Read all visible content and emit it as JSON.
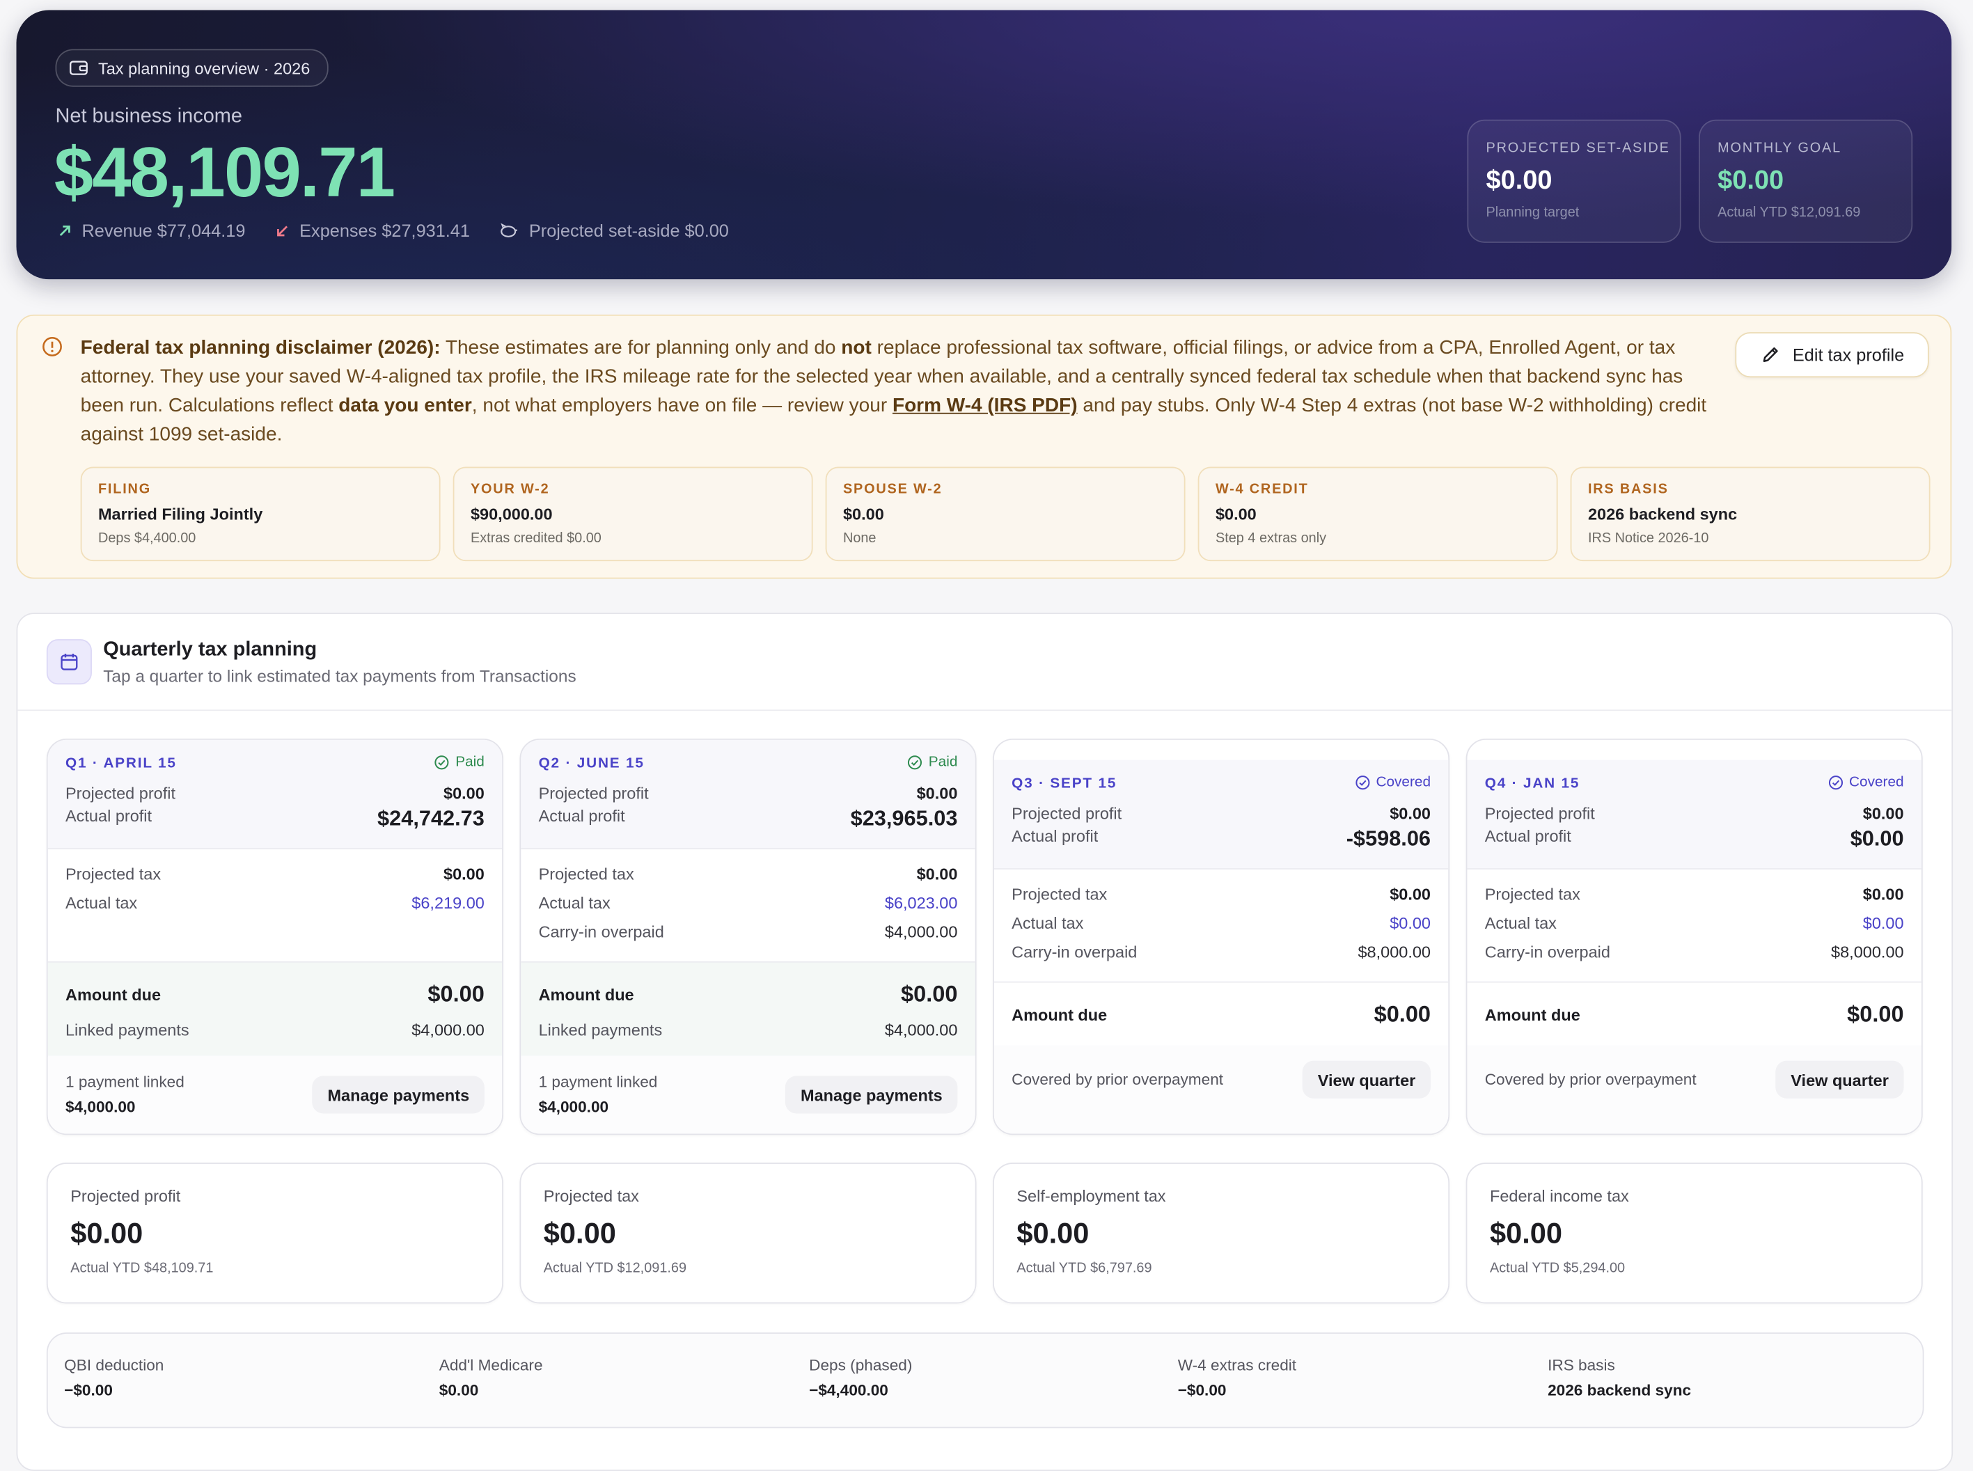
{
  "hero": {
    "pill": "Tax planning overview · 2026",
    "label": "Net business income",
    "amount": "$48,109.71",
    "revenue": "Revenue $77,044.19",
    "expenses": "Expenses $27,931.41",
    "set_aside": "Projected set-aside $0.00",
    "cards": [
      {
        "label": "Projected set-aside",
        "value": "$0.00",
        "sub": "Planning target",
        "color": "#ffffff"
      },
      {
        "label": "Monthly goal",
        "value": "$0.00",
        "sub": "Actual YTD $12,091.69",
        "color": "#7ee2b4"
      }
    ]
  },
  "disclaimer": {
    "title": "Federal tax planning disclaimer (2026):",
    "t1": " These estimates are for planning only and do ",
    "not": "not",
    "t2": " replace professional tax software, official filings, or advice from a CPA, Enrolled Agent, or tax attorney. They use your saved W-4-aligned tax profile, the IRS mileage rate for the selected year when available, and a centrally synced federal tax schedule when that backend sync has been run. Calculations reflect ",
    "data_you_enter": "data you enter",
    "t3": ", not what employers have on file — review your ",
    "link": "Form W-4 (IRS PDF)",
    "t4": " and pay stubs. Only W-4 Step 4 extras (not base W-2 withholding) credit against 1099 set-aside.",
    "edit_button": "Edit tax profile",
    "tiles": [
      {
        "label": "FILING",
        "value": "Married Filing Jointly",
        "sub": "Deps $4,400.00"
      },
      {
        "label": "YOUR W-2",
        "value": "$90,000.00",
        "sub": "Extras credited $0.00"
      },
      {
        "label": "SPOUSE W-2",
        "value": "$0.00",
        "sub": "None"
      },
      {
        "label": "W-4 CREDIT",
        "value": "$0.00",
        "sub": "Step 4 extras only"
      },
      {
        "label": "IRS BASIS",
        "value": "2026 backend sync",
        "sub": "IRS Notice 2026-10"
      }
    ]
  },
  "quarterly": {
    "title": "Quarterly tax planning",
    "subtitle": "Tap a quarter to link estimated tax payments from Transactions",
    "labels": {
      "projected_profit": "Projected profit",
      "actual_profit": "Actual profit",
      "projected_tax": "Projected tax",
      "actual_tax": "Actual tax",
      "carry_in": "Carry-in overpaid",
      "amount_due": "Amount due",
      "linked_payments": "Linked payments"
    },
    "quarters": [
      {
        "name": "Q1 · APRIL 15",
        "status": "Paid",
        "projected_profit": "$0.00",
        "actual_profit": "$24,742.73",
        "projected_tax": "$0.00",
        "actual_tax": "$6,219.00",
        "amount_due": "$0.00",
        "linked_payments": "$4,000.00",
        "foot_label": "1 payment linked",
        "foot_value": "$4,000.00",
        "button": "Manage payments"
      },
      {
        "name": "Q2 · JUNE 15",
        "status": "Paid",
        "projected_profit": "$0.00",
        "actual_profit": "$23,965.03",
        "projected_tax": "$0.00",
        "actual_tax": "$6,023.00",
        "carry_in": "$4,000.00",
        "amount_due": "$0.00",
        "linked_payments": "$4,000.00",
        "foot_label": "1 payment linked",
        "foot_value": "$4,000.00",
        "button": "Manage payments"
      },
      {
        "name": "Q3 · SEPT 15",
        "status": "Covered",
        "projected_profit": "$0.00",
        "actual_profit": "-$598.06",
        "projected_tax": "$0.00",
        "actual_tax": "$0.00",
        "carry_in": "$8,000.00",
        "amount_due": "$0.00",
        "foot_label": "Covered by prior overpayment",
        "button": "View quarter"
      },
      {
        "name": "Q4 · JAN 15",
        "status": "Covered",
        "projected_profit": "$0.00",
        "actual_profit": "$0.00",
        "projected_tax": "$0.00",
        "actual_tax": "$0.00",
        "carry_in": "$8,000.00",
        "amount_due": "$0.00",
        "foot_label": "Covered by prior overpayment",
        "button": "View quarter"
      }
    ],
    "summary": [
      {
        "label": "Projected profit",
        "value": "$0.00",
        "sub": "Actual YTD $48,109.71"
      },
      {
        "label": "Projected tax",
        "value": "$0.00",
        "sub": "Actual YTD $12,091.69"
      },
      {
        "label": "Self-employment tax",
        "value": "$0.00",
        "sub": "Actual YTD $6,797.69"
      },
      {
        "label": "Federal income tax",
        "value": "$0.00",
        "sub": "Actual YTD $5,294.00"
      }
    ],
    "strip": [
      {
        "label": "QBI deduction",
        "value": "−$0.00"
      },
      {
        "label": "Add'l Medicare",
        "value": "$0.00"
      },
      {
        "label": "Deps (phased)",
        "value": "−$4,400.00"
      },
      {
        "label": "W-4 extras credit",
        "value": "−$0.00"
      },
      {
        "label": "IRS basis",
        "value": "2026 backend sync"
      }
    ]
  }
}
